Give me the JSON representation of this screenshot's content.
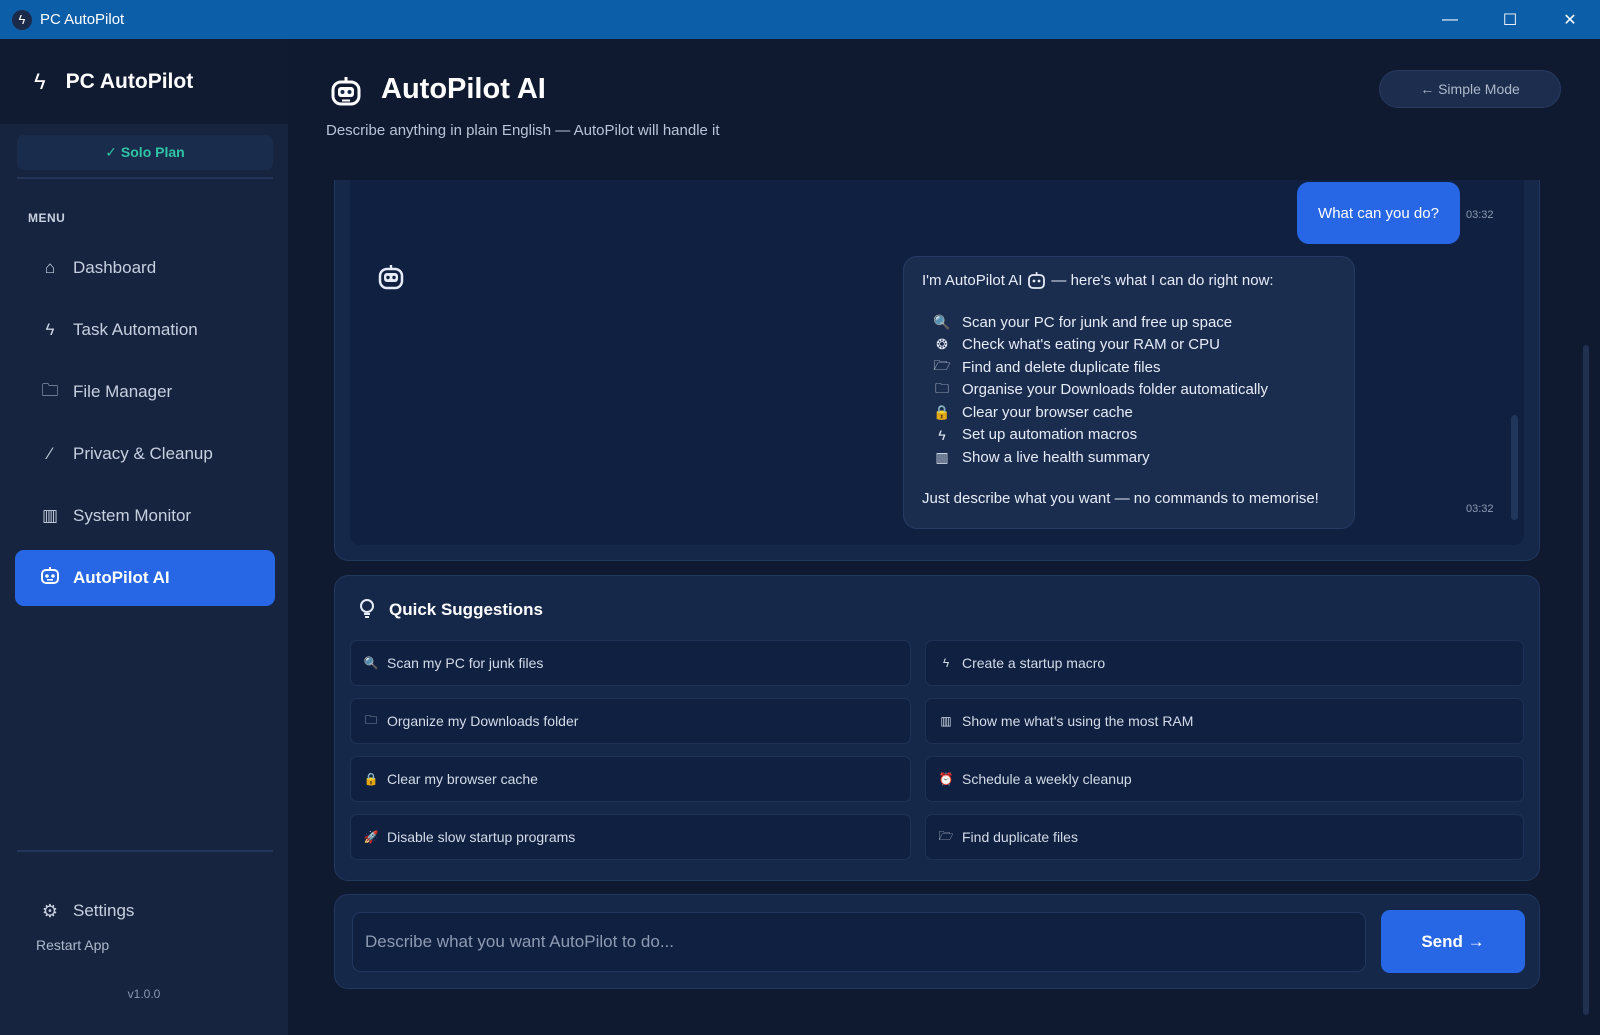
{
  "window": {
    "title": "PC AutoPilot",
    "controls": {
      "minimize": "—",
      "maximize": "☐",
      "close": "✕"
    }
  },
  "sidebar": {
    "brand": "PC AutoPilot",
    "plan_badge": "✓ Solo Plan",
    "menu_label": "MENU",
    "items": [
      {
        "label": "Dashboard",
        "icon": "home-icon",
        "glyph": "⌂",
        "active": false
      },
      {
        "label": "Task Automation",
        "icon": "bolt-icon",
        "glyph": "ϟ",
        "active": false
      },
      {
        "label": "File Manager",
        "icon": "folder-icon",
        "glyph": "🗀",
        "active": false
      },
      {
        "label": "Privacy & Cleanup",
        "icon": "brush-icon",
        "glyph": "⁄",
        "active": false
      },
      {
        "label": "System Monitor",
        "icon": "chart-icon",
        "glyph": "▥",
        "active": false
      },
      {
        "label": "AutoPilot AI",
        "icon": "robot-icon",
        "glyph": "",
        "active": true
      }
    ],
    "settings_label": "Settings",
    "restart_label": "Restart App",
    "version": "v1.0.0"
  },
  "header": {
    "title": "AutoPilot AI",
    "subtitle": "Describe anything in plain English — AutoPilot will handle it",
    "simple_mode_label": "← Simple Mode"
  },
  "chat": {
    "user_message": {
      "text": "What can you do?",
      "time": "03:32"
    },
    "bot_message": {
      "intro_before": "I'm AutoPilot AI",
      "intro_after": "— here's what I can do right now:",
      "capabilities": [
        {
          "icon": "magnifier-icon",
          "glyph": "🔍",
          "text": "Scan your PC for junk and free up space"
        },
        {
          "icon": "brain-icon",
          "glyph": "❂",
          "text": "Check what's eating your RAM or CPU"
        },
        {
          "icon": "open-folder-icon",
          "glyph": "🗁",
          "text": "Find and delete duplicate files"
        },
        {
          "icon": "folder-icon",
          "glyph": "🗀",
          "text": "Organise your Downloads folder automatically"
        },
        {
          "icon": "lock-icon",
          "glyph": "🔒",
          "text": "Clear your browser cache"
        },
        {
          "icon": "bolt-icon",
          "glyph": "ϟ",
          "text": "Set up automation macros"
        },
        {
          "icon": "chart-icon",
          "glyph": "▥",
          "text": "Show a live health summary"
        }
      ],
      "outro": "Just describe what you want — no commands to memorise!",
      "time": "03:32"
    }
  },
  "suggestions": {
    "title": "Quick Suggestions",
    "items": [
      {
        "icon": "magnifier-icon",
        "glyph": "🔍",
        "text": "Scan my PC for junk files"
      },
      {
        "icon": "bolt-icon",
        "glyph": "ϟ",
        "text": "Create a startup macro"
      },
      {
        "icon": "folder-icon",
        "glyph": "🗀",
        "text": "Organize my Downloads folder"
      },
      {
        "icon": "chart-icon",
        "glyph": "▥",
        "text": "Show me what's using the most RAM"
      },
      {
        "icon": "lock-icon",
        "glyph": "🔒",
        "text": "Clear my browser cache"
      },
      {
        "icon": "alarm-clock-icon",
        "glyph": "⏰",
        "text": "Schedule a weekly cleanup"
      },
      {
        "icon": "rocket-icon",
        "glyph": "🚀",
        "text": "Disable slow startup programs"
      },
      {
        "icon": "open-folder-icon",
        "glyph": "🗁",
        "text": "Find duplicate files"
      }
    ]
  },
  "input": {
    "placeholder": "Describe what you want AutoPilot to do...",
    "value": "",
    "send_label": "Send →"
  },
  "colors": {
    "accent": "#2767e6",
    "titlebar": "#0d5ea8",
    "plan_green": "#2ec4a6",
    "background": "#0f1a30"
  }
}
